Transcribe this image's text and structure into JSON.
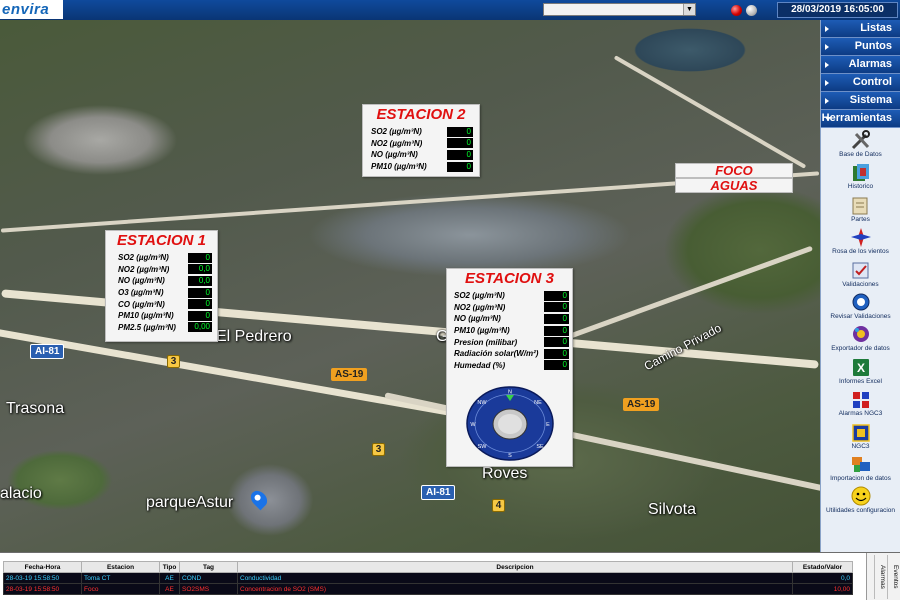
{
  "header": {
    "logo": "envira",
    "station_select": "",
    "datetime": "28/03/2019 16:05:00"
  },
  "map_labels": {
    "el_pedrero": "El Pedrero",
    "trasona": "Trasona",
    "alacio": "alacio",
    "parque_astur": "parqueAstur",
    "roves": "Roves",
    "silvota": "Silvota",
    "camino_privado": "Camino Privado",
    "g": "G",
    "ai81_a": "AI-81",
    "ai81_b": "AI-81",
    "as19_a": "AS-19",
    "as19_b": "AS-19",
    "three_a": "3",
    "three_b": "3",
    "four": "4"
  },
  "stations": {
    "st1": {
      "title": "ESTACION 1",
      "rows": [
        {
          "label": "SO2 (µg/m³N)",
          "value": "0"
        },
        {
          "label": "NO2 (µg/m³N)",
          "value": "0,0"
        },
        {
          "label": "NO (µg/m³N)",
          "value": "0,0"
        },
        {
          "label": "O3 (µg/m³N)",
          "value": "0"
        },
        {
          "label": "CO (µg/m³N)",
          "value": "0"
        },
        {
          "label": "PM10 (µg/m³N)",
          "value": "0"
        },
        {
          "label": "PM2.5 (µg/m³N)",
          "value": "0,00"
        }
      ]
    },
    "st2": {
      "title": "ESTACION 2",
      "rows": [
        {
          "label": "SO2 (µg/m³N)",
          "value": "0"
        },
        {
          "label": "NO2 (µg/m³N)",
          "value": "0"
        },
        {
          "label": "NO (µg/m³N)",
          "value": "0"
        },
        {
          "label": "PM10 (µg/m³N)",
          "value": "0"
        }
      ]
    },
    "st3": {
      "title": "ESTACION 3",
      "rows": [
        {
          "label": "SO2 (µg/m³N)",
          "value": "0"
        },
        {
          "label": "NO2 (µg/m³N)",
          "value": "0"
        },
        {
          "label": "NO (µg/m³N)",
          "value": "0"
        },
        {
          "label": "PM10 (µg/m³N)",
          "value": "0"
        },
        {
          "label": "Presion (milibar)",
          "value": "0"
        },
        {
          "label": "Radiación solar(W/m²)",
          "value": "0"
        },
        {
          "label": "Humedad (%)",
          "value": "0"
        }
      ],
      "compass": {
        "N": "N",
        "NE": "NE",
        "E": "E",
        "SE": "SE",
        "S": "S",
        "SW": "SW",
        "W": "W",
        "NW": "NW"
      }
    }
  },
  "foco": {
    "line1": "FOCO",
    "line2": "AGUAS"
  },
  "sidebar": {
    "menus": [
      "Listas",
      "Puntos",
      "Alarmas",
      "Control",
      "Sistema",
      "Herramientas"
    ],
    "tools": [
      {
        "label": "Base de Datos",
        "icon": "database-tools-icon"
      },
      {
        "label": "Historico",
        "icon": "history-icon"
      },
      {
        "label": "Partes",
        "icon": "reports-icon"
      },
      {
        "label": "Rosa de los vientos",
        "icon": "wind-rose-icon"
      },
      {
        "label": "Validaciones",
        "icon": "validation-icon"
      },
      {
        "label": "Revisar Validaciones",
        "icon": "review-validation-icon"
      },
      {
        "label": "Exportador de datos",
        "icon": "data-export-icon"
      },
      {
        "label": "Informes Excel",
        "icon": "excel-icon"
      },
      {
        "label": "Alarmas NGC3",
        "icon": "ngc3-alarm-icon"
      },
      {
        "label": "NGC3",
        "icon": "ngc3-icon"
      },
      {
        "label": "Importacion de datos",
        "icon": "data-import-icon"
      },
      {
        "label": "Utilidades configuracion",
        "icon": "smiley-icon"
      }
    ]
  },
  "alarms": {
    "headers": [
      "Fecha-Hora",
      "Estacion",
      "Tipo",
      "Tag",
      "Descripcion",
      "Estado/Valor"
    ],
    "rows": [
      {
        "datetime": "28-03-19 15:58:50",
        "station": "Toma CT",
        "type": "AE",
        "tag": "COND",
        "description": "Conductividad",
        "value": "0,0",
        "color": "cyan"
      },
      {
        "datetime": "28-03-19 15:58:50",
        "station": "Foco",
        "type": "AE",
        "tag": "SO2SMS",
        "description": "Concentracion de SO2 (SMS)",
        "value": "10,00",
        "color": "red"
      }
    ],
    "tabs": [
      "Alarmas",
      "Eventos"
    ]
  }
}
